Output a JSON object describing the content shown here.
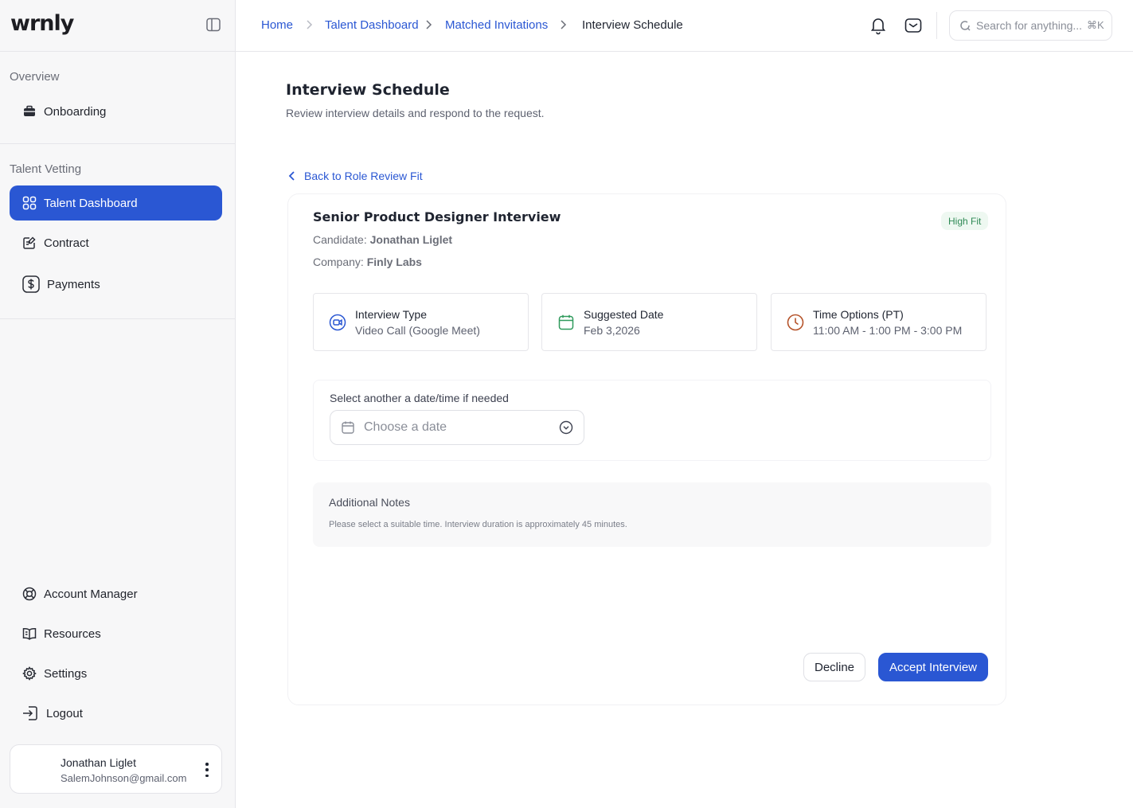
{
  "brand": {
    "logo": "wrnly"
  },
  "sidebar": {
    "overview_title": "Overview",
    "overview_items": [
      {
        "label": "Onboarding",
        "icon": "briefcase-icon"
      }
    ],
    "vetting_title": "Talent Vetting",
    "vetting_items": [
      {
        "label": "Talent Dashboard",
        "icon": "grid-icon",
        "active": true
      },
      {
        "label": "Contract",
        "icon": "contract-icon"
      },
      {
        "label": "Payments",
        "icon": "dollar-icon"
      }
    ],
    "bottom_items": [
      {
        "label": "Account Manager",
        "icon": "lifebuoy-icon"
      },
      {
        "label": "Resources",
        "icon": "book-icon"
      },
      {
        "label": "Settings",
        "icon": "gear-icon"
      },
      {
        "label": "Logout",
        "icon": "logout-icon"
      }
    ],
    "user": {
      "name": "Jonathan Liglet",
      "email": "SalemJohnson@gmail.com"
    }
  },
  "header": {
    "breadcrumbs": [
      "Home",
      "Talent Dashboard",
      "Matched Invitations",
      "Interview Schedule"
    ],
    "search_placeholder": "Search for anything...",
    "search_shortcut": "⌘K"
  },
  "main": {
    "title": "Interview Schedule",
    "subtitle": "Review interview details and respond to the request.",
    "back_label": "Back to Role Review Fit",
    "card": {
      "title": "Senior Product Designer Interview",
      "badge": "High Fit",
      "candidate_label": "Candidate:",
      "candidate": "Jonathan Liglet",
      "company_label": "Company:",
      "company": "Finly Labs",
      "info": [
        {
          "label": "Interview Type",
          "value": "Video Call (Google Meet)",
          "icon": "video-icon",
          "color": "#2a57d3"
        },
        {
          "label": "Suggested Date",
          "value": "Feb 3,2026",
          "icon": "calendar-icon",
          "color": "#2f9a5c"
        },
        {
          "label": "Time Options (PT)",
          "value": "11:00 AM - 1:00 PM - 3:00 PM",
          "icon": "clock-icon",
          "color": "#b5532a"
        }
      ],
      "picker_label": "Select another a date/time if needed",
      "date_placeholder": "Choose a date",
      "notes_title": "Additional Notes",
      "notes_body": "Please select a suitable time. Interview duration is approximately 45 minutes.",
      "decline_label": "Decline",
      "accept_label": "Accept Interview"
    }
  },
  "colors": {
    "accent": "#2a57d3",
    "badge_bg": "#eef8f1",
    "badge_text": "#2f8a55"
  }
}
